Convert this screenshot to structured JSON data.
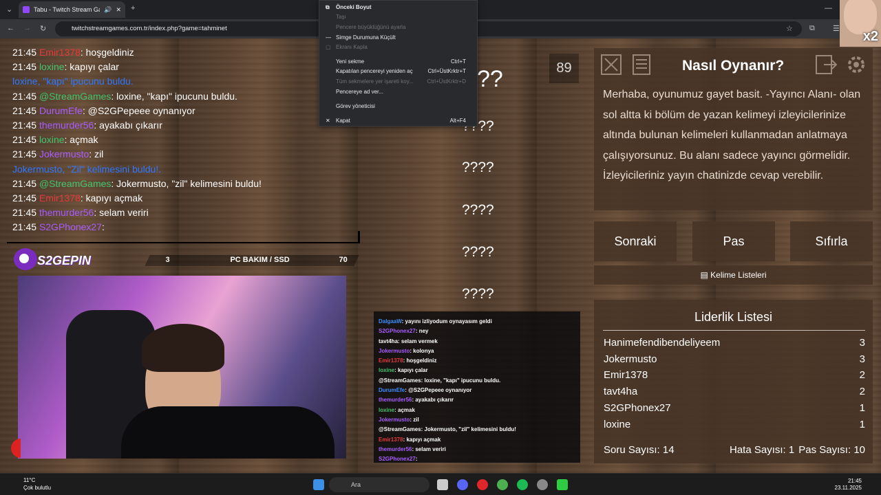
{
  "browser": {
    "tab_title": "Tabu - Twitch Stream Game",
    "url": "twitchstreamgames.com.tr/index.php?game=tahminet"
  },
  "context_menu": {
    "items": [
      {
        "label": "Önceki Boyut",
        "shortcut": "",
        "disabled": false,
        "bold": true
      },
      {
        "label": "Taşı",
        "shortcut": "",
        "disabled": true
      },
      {
        "label": "Pencere büyüklüğünü ayarla",
        "shortcut": "",
        "disabled": true
      },
      {
        "label": "Simge Durumuna Küçült",
        "shortcut": "",
        "disabled": false
      },
      {
        "label": "Ekranı Kapla",
        "shortcut": "",
        "disabled": true
      },
      {
        "label": "Yeni sekme",
        "shortcut": "Ctrl+T",
        "disabled": false
      },
      {
        "label": "Kapatılan pencereyi yeniden aç",
        "shortcut": "Ctrl+ÜstKrktr+T",
        "disabled": false
      },
      {
        "label": "Tüm sekmelere yer işareti koy...",
        "shortcut": "Ctrl+ÜstKrktr+D",
        "disabled": true
      },
      {
        "label": "Pencereye ad ver...",
        "shortcut": "",
        "disabled": false
      },
      {
        "label": "Görev yöneticisi",
        "shortcut": "",
        "disabled": false
      },
      {
        "label": "Kapat",
        "shortcut": "Alt+F4",
        "disabled": false
      }
    ]
  },
  "chat": {
    "messages": [
      {
        "time": "21:45",
        "user": "Emir1378",
        "text": ": hoşgeldiniz",
        "color": "red"
      },
      {
        "time": "21:45",
        "user": "loxine",
        "text": ": kapıyı çalar",
        "color": "green"
      },
      {
        "time": "",
        "user": "loxine, \"kapı\" ipucunu buldu.",
        "text": "",
        "color": "blue"
      },
      {
        "time": "21:45",
        "user": "@StreamGames",
        "text": ": loxine, \"kapı\" ipucunu buldu.",
        "color": "green"
      },
      {
        "time": "21:45",
        "user": "DurumEfe",
        "text": ": @S2GPepeee oynanıyor",
        "color": "purple"
      },
      {
        "time": "21:45",
        "user": "themurder56",
        "text": ": ayakabı çıkarır",
        "color": "purple"
      },
      {
        "time": "21:45",
        "user": "loxine",
        "text": ": açmak",
        "color": "green"
      },
      {
        "time": "21:45",
        "user": "Jokermusto",
        "text": ": zil",
        "color": "purple"
      },
      {
        "time": "",
        "user": "Jokermusto, \"Zil\" kelimesini buldu!.",
        "text": "",
        "color": "blue"
      },
      {
        "time": "21:45",
        "user": "@StreamGames",
        "text": ": Jokermusto, \"zil\" kelimesini buldu!",
        "color": "green"
      },
      {
        "time": "21:45",
        "user": "Emir1378",
        "text": ": kapıyı açmak",
        "color": "red"
      },
      {
        "time": "21:45",
        "user": "themurder56",
        "text": ": selam veriri",
        "color": "purple"
      },
      {
        "time": "21:45",
        "user": "S2GPhonex27",
        "text": ": ",
        "color": "purple"
      }
    ]
  },
  "streambar": {
    "brand": "S2GEPIN",
    "count": "3",
    "label": "PC BAKIM / SSD",
    "value": "70"
  },
  "game": {
    "counter": "89",
    "hidden_words": [
      "??",
      "????",
      "????",
      "????",
      "????",
      "????"
    ]
  },
  "mini_chat": {
    "messages": [
      {
        "user": "DalgaaW",
        "text": ": yayını izliyodum oynayasım geldi"
      },
      {
        "user": "S2GPhonex27",
        "text": ": ney"
      },
      {
        "user": "tavt4ha",
        "text": ": selam vermek"
      },
      {
        "user": "Jokermusto",
        "text": ": kolonya"
      },
      {
        "user": "Emir1378",
        "text": ": hoşgeldiniz"
      },
      {
        "user": "loxine",
        "text": ": kapıyı çalar"
      },
      {
        "user": "@StreamGames",
        "text": ": loxine, \"kapı\" ipucunu buldu."
      },
      {
        "user": "DurumEfe",
        "text": ": @S2GPepeee oynanıyor"
      },
      {
        "user": "themurder56",
        "text": ": ayakabı çıkarır"
      },
      {
        "user": "loxine",
        "text": ": açmak"
      },
      {
        "user": "Jokermusto",
        "text": ": zil"
      },
      {
        "user": "@StreamGames",
        "text": ": Jokermusto, \"zil\" kelimesini buldu!"
      },
      {
        "user": "Emir1378",
        "text": ": kapıyı açmak"
      },
      {
        "user": "themurder56",
        "text": ": selam veriri"
      },
      {
        "user": "S2GPhonex27",
        "text": ": "
      }
    ]
  },
  "howto": {
    "title": "Nasıl Oynanır?",
    "body": "Merhaba, oyunumuz gayet basit. -Yayıncı Alanı- olan sol altta ki bölüm de yazan kelimeyi izleyicilerinize altında bulunan kelimeleri kullanmadan anlatmaya çalışıyorsunuz. Bu alanı sadece yayıncı görmelidir. İzleyicileriniz yayın chatinizde cevap verebilir."
  },
  "actions": {
    "next": "Sonraki",
    "pass": "Pas",
    "reset": "Sıfırla",
    "word_lists": "Kelime Listeleri"
  },
  "leaderboard": {
    "title": "Liderlik Listesi",
    "rows": [
      {
        "name": "Hanimefendibendeliyeem",
        "score": "3"
      },
      {
        "name": "Jokermusto",
        "score": "3"
      },
      {
        "name": "Emir1378",
        "score": "2"
      },
      {
        "name": "tavt4ha",
        "score": "2"
      },
      {
        "name": "S2GPhonex27",
        "score": "1"
      },
      {
        "name": "loxine",
        "score": "1"
      }
    ],
    "questions": "Soru Sayısı: 14",
    "errors": "Hata Sayısı: 1",
    "passes": "Pas Sayısı: 10"
  },
  "webcam_overlay": "x2",
  "taskbar": {
    "temp": "11°C",
    "weather": "Çok bulutlu",
    "search": "Ara",
    "time": "21:45",
    "date": "23.11.2025"
  },
  "colors": {
    "accent": "#9146ff",
    "wood": "#5a4331",
    "panel": "#463426"
  }
}
